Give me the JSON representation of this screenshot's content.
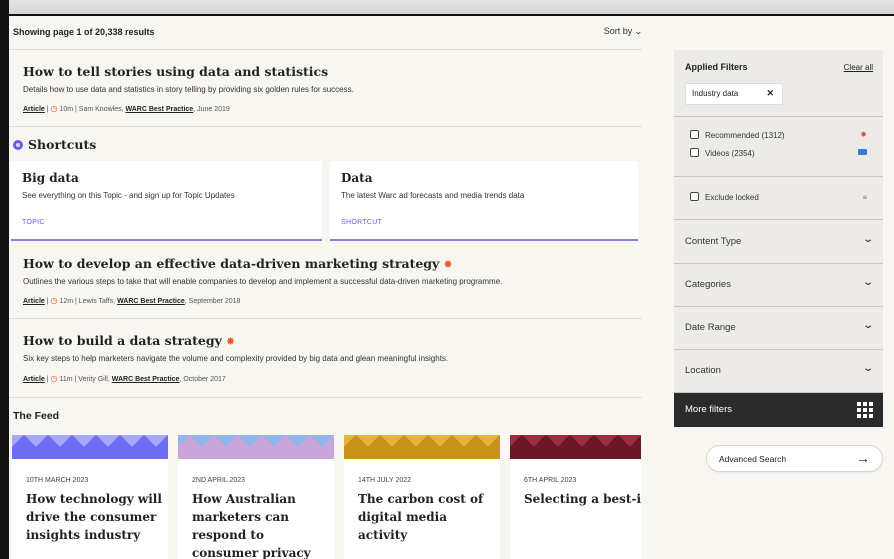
{
  "results": {
    "count_text": "Showing page 1 of 20,338 results",
    "sort_label": "Sort by"
  },
  "articles": [
    {
      "title": "How to tell stories using data and statistics",
      "starred": false,
      "description": "Details how to use data and statistics in story telling by providing six golden rules for success.",
      "type": "Article",
      "read_time": "10m",
      "author": "Sam Knowles,",
      "source": "WARC Best Practice",
      "date": ", June 2019"
    },
    {
      "title": "How to develop an effective data-driven marketing strategy",
      "starred": true,
      "description": "Outlines the various steps to take that will enable companies to develop and implement a successful data-driven marketing programme.",
      "type": "Article",
      "read_time": "12m",
      "author": "Lewis Taffs,",
      "source": "WARC Best Practice",
      "date": ", September 2018"
    },
    {
      "title": "How to build a data strategy",
      "starred": true,
      "description": "Six key steps to help marketers navigate the volume and complexity provided by big data and glean meaningful insights.",
      "type": "Article",
      "read_time": "11m",
      "author": "Verity Gill,",
      "source": "WARC Best Practice",
      "date": ", October 2017"
    }
  ],
  "shortcuts": {
    "heading": "Shortcuts",
    "cards": [
      {
        "title": "Big data",
        "description": "See everything on this Topic - and sign up for Topic Updates",
        "tag": "TOPIC"
      },
      {
        "title": "Data",
        "description": "The latest Warc ad forecasts and media trends data",
        "tag": "SHORTCUT"
      }
    ]
  },
  "feed": {
    "heading": "The Feed",
    "cards": [
      {
        "date": "10TH MARCH 2023",
        "title": "How technology will drive the consumer insights industry",
        "color_a": "#6f6cf5",
        "color_b": "#a9a6ff"
      },
      {
        "date": "2ND APRIL 2023",
        "title": "How Australian marketers can respond to consumer privacy changes",
        "color_a": "#c9a6d9",
        "color_b": "#8fb7ee"
      },
      {
        "date": "14TH JULY 2022",
        "title": "The carbon cost of digital media activity",
        "color_a": "#c7921a",
        "color_b": "#e5b43c"
      },
      {
        "date": "6TH APRIL 2023",
        "title": "Selecting a best-in-class data clean roo",
        "color_a": "#6b1626",
        "color_b": "#9a2e3f"
      }
    ]
  },
  "sidebar": {
    "applied_title": "Applied Filters",
    "clear_all": "Clear all",
    "chip_label": "Industry data",
    "checkboxes": [
      {
        "label": "Recommended (1312)",
        "icon": "star-icon"
      },
      {
        "label": "Videos (2354)",
        "icon": "video-icon"
      }
    ],
    "exclude_locked": "Exclude locked",
    "accordions": [
      "Content Type",
      "Categories",
      "Date Range",
      "Location"
    ],
    "more_filters": "More filters"
  },
  "advanced_search": "Advanced Search",
  "colors": {
    "accent_star": "#e8562a",
    "accent_purple": "#6c5ce7",
    "sidebar_bg": "#ecebe7",
    "dark_button": "#2b2b2b"
  }
}
